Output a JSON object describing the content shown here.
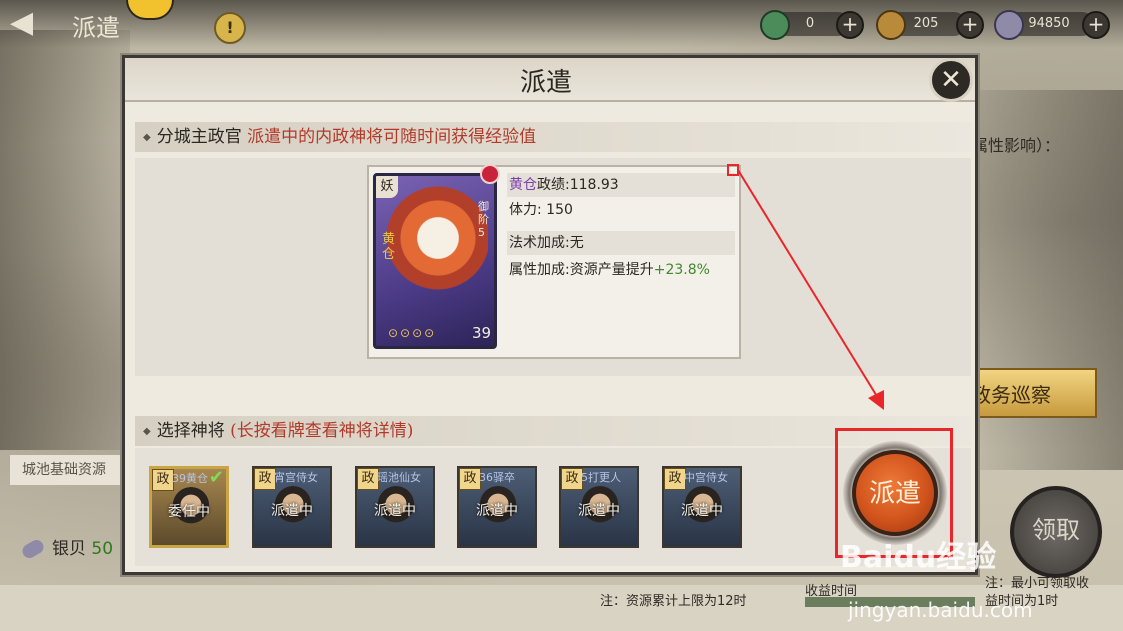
{
  "topbar": {
    "back_glyph": "◀",
    "title": "派遣",
    "alert_glyph": "!",
    "resources": [
      {
        "icon": "jade-coin-icon",
        "value": "0",
        "color": "#4b8c5a"
      },
      {
        "icon": "copper-coin-icon",
        "value": "205",
        "color": "#b88a3a"
      },
      {
        "icon": "silver-shell-icon",
        "value": "94850",
        "color": "#8f8aa8"
      }
    ],
    "plus_glyph": "+"
  },
  "background": {
    "resource_tab": "城池基础资源",
    "silver_label": "银贝",
    "silver_value": "50",
    "right_label": "属性影响）：",
    "patrol_button": "政务巡察",
    "claim_button": "领取",
    "income_label": "收益时间",
    "min_claim_note_1": "注：最小可领取收",
    "min_claim_note_2": "益时间为1时"
  },
  "modal": {
    "title": "派遣",
    "close_glyph": "✕",
    "section1": {
      "label": "分城主政官",
      "hint": "派遣中的内政神将可随时间获得经验值"
    },
    "general": {
      "race": "妖",
      "name": "黄仓",
      "type": "御阶5",
      "level": "39",
      "stars": "⊙⊙⊙⊙",
      "stats": [
        {
          "label": "政绩:",
          "value": "118.93"
        },
        {
          "label": "体力:",
          "value": "150"
        },
        {
          "label": "法术加成:",
          "value": "无"
        },
        {
          "label": "属性加成:",
          "value": "资源产量提升",
          "bonus": "+23.8%"
        }
      ]
    },
    "section2": {
      "label": "选择神将",
      "hint": "(长按看牌查看神将详情)"
    },
    "heroes": [
      {
        "tag": "政",
        "name": "39黄仓",
        "status": "委任中",
        "selected": true
      },
      {
        "tag": "政",
        "name": "宵宫侍女",
        "status": "派遣中",
        "selected": false
      },
      {
        "tag": "政",
        "name": "瑶池仙女",
        "status": "派遣中",
        "selected": false
      },
      {
        "tag": "政",
        "name": "36驿卒",
        "status": "派遣中",
        "selected": false
      },
      {
        "tag": "政",
        "name": "5打更人",
        "status": "派遣中",
        "selected": false
      },
      {
        "tag": "政",
        "name": "中宫侍女",
        "status": "派遣中",
        "selected": false
      }
    ],
    "dispatch_button": "派遣",
    "note": "注：资源累计上限为12时"
  },
  "watermark": {
    "brand": "Baidu经验",
    "url": "jingyan.baidu.com"
  }
}
